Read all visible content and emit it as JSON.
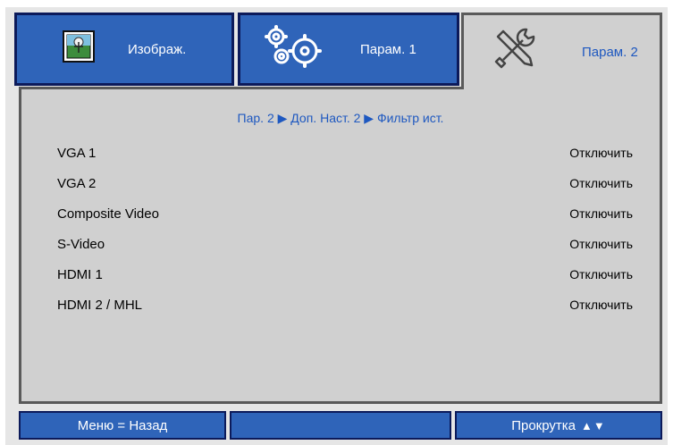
{
  "tabs": [
    {
      "label": "Изображ.",
      "icon": "image-icon",
      "active": false
    },
    {
      "label": "Парам. 1",
      "icon": "gears-icon",
      "active": false
    },
    {
      "label": "Парам. 2",
      "icon": "tools-icon",
      "active": true
    }
  ],
  "breadcrumb": "Пар. 2 ▶ Доп. Наст. 2 ▶ Фильтр ист.",
  "rows": [
    {
      "label": "VGA 1",
      "value": "Отключить"
    },
    {
      "label": "VGA 2",
      "value": "Отключить"
    },
    {
      "label": "Composite Video",
      "value": "Отключить"
    },
    {
      "label": "S-Video",
      "value": "Отключить"
    },
    {
      "label": "HDMI 1",
      "value": "Отключить"
    },
    {
      "label": "HDMI 2 / MHL",
      "value": "Отключить"
    }
  ],
  "footer": {
    "back_label": "Меню = Назад",
    "middle_label": "",
    "scroll_label": "Прокрутка",
    "scroll_arrows": "▲▼"
  },
  "colors": {
    "tab_blue": "#2f64b9",
    "accent_text": "#1e58c0",
    "panel_gray": "#d0d0d0"
  }
}
